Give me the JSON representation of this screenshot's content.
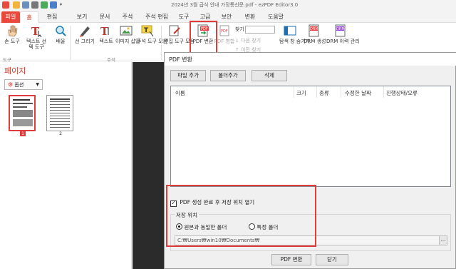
{
  "titlebar": {
    "title": "2024년 3월 급식 안내 가정통신문.pdf - ezPDF Editor3.0"
  },
  "menu": {
    "tabs": [
      "파일",
      "홈",
      "편집",
      "보기",
      "문서",
      "주석",
      "주석 편집",
      "도구",
      "고급",
      "보안",
      "변환",
      "도움말"
    ],
    "active": "홈"
  },
  "ribbon": {
    "buttons": [
      {
        "label": "손 도구",
        "icon": "hand-icon"
      },
      {
        "label": "텍스트 선택 도구",
        "icon": "text-select-icon"
      },
      {
        "label": "배율",
        "icon": "zoom-icon"
      },
      {
        "label": "선 그리기",
        "icon": "pen-icon"
      },
      {
        "label": "텍스트",
        "icon": "text-icon"
      },
      {
        "label": "이미지 삽입",
        "icon": "image-icon"
      },
      {
        "label": "주석 도구 모음",
        "icon": "annotation-tool-icon"
      },
      {
        "label": "편집 도구 모음",
        "icon": "edit-tool-icon"
      },
      {
        "label": "PDF 변환",
        "icon": "pdf-convert-icon"
      },
      {
        "label": "PDF 병합",
        "icon": "pdf-merge-icon"
      },
      {
        "label": "탐색 창 숨기기",
        "icon": "nav-pane-icon"
      },
      {
        "label": "DRM 생성",
        "icon": "drm-create-icon"
      },
      {
        "label": "DRM 이력 관리",
        "icon": "drm-history-icon"
      }
    ],
    "groups": {
      "tools": "도구",
      "annotation": "주석"
    },
    "find": {
      "label": "찾기",
      "next": "다음 찾기",
      "prev": "이전 찾기"
    }
  },
  "leftpanel": {
    "title": "페이지",
    "options_label": "옵션",
    "pages": [
      "1",
      "2"
    ],
    "selected_page": "1"
  },
  "dialog": {
    "title": "PDF 변환",
    "buttons": {
      "add_file": "파일 추가",
      "add_folder": "폴더추가",
      "delete": "삭제"
    },
    "columns": [
      "이름",
      "크기",
      "종류",
      "수정한 날짜",
      "진행상태/오류"
    ],
    "open_after_label": "PDF 생성 완료 후 저장 위치 열기",
    "open_after_checked": true,
    "save_location": {
      "label": "저장 위치",
      "option_same": "원본과 동일한 폴더",
      "option_specific": "특정 폴더",
      "selected": "원본과 동일한 폴더",
      "path": "C:₩Users₩win10₩Documents₩"
    },
    "convert_label": "PDF 변환",
    "close_label": "닫기"
  },
  "colors": {
    "accent": "#e23b3b",
    "brand": "#d8372a",
    "canvas": "#2b2b2b"
  }
}
